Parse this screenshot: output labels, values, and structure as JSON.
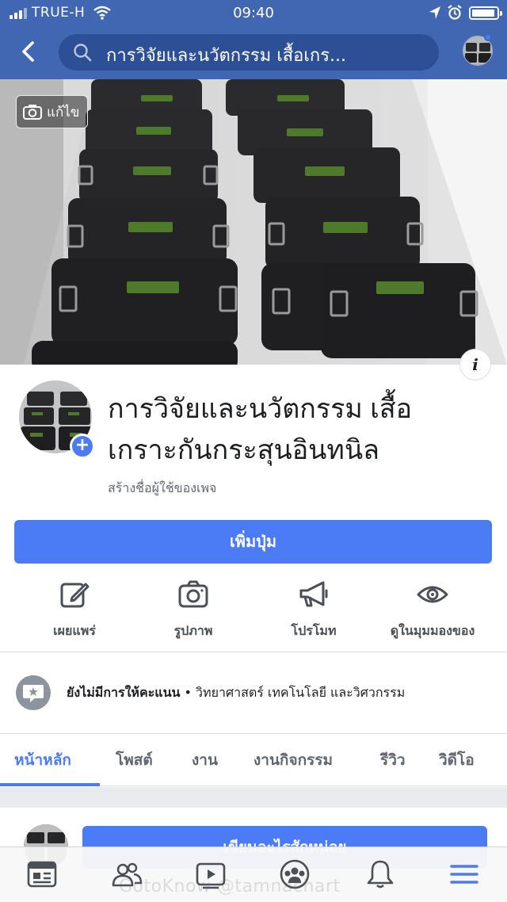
{
  "status_bar": {
    "carrier": "TRUE-H",
    "time": "09:40"
  },
  "header": {
    "search_text": "การวิจัยและนวัตกรรม เสื้อเกร...",
    "back_icon": "chevron-left-icon",
    "search_icon": "search-icon"
  },
  "cover": {
    "edit_label": "แก้ไข",
    "info_label": "i"
  },
  "profile": {
    "page_name": "การวิจัยและนวัตกรรม เสื้อเกราะกันกระสุนอินทนิล",
    "create_username": "สร้างชื่อผู้ใช้ของเพจ"
  },
  "primary_button": "เพิ่มปุ่ม",
  "actions": [
    {
      "label": "เผยแพร่",
      "icon": "edit-icon"
    },
    {
      "label": "รูปภาพ",
      "icon": "camera-icon"
    },
    {
      "label": "โปรโมท",
      "icon": "megaphone-icon"
    },
    {
      "label": "ดูในมุมมองของ",
      "icon": "eye-icon"
    }
  ],
  "rating": {
    "no_rating": "ยังไม่มีการให้คะแนน",
    "separator": " • ",
    "category": "วิทยาศาสตร์ เทคโนโลยี และวิศวกรรม"
  },
  "tabs": [
    {
      "label": "หน้าหลัก",
      "active": true
    },
    {
      "label": "โพสต์",
      "active": false
    },
    {
      "label": "งาน",
      "active": false
    },
    {
      "label": "งานกิจกรรม",
      "active": false
    },
    {
      "label": "รีวิว",
      "active": false
    },
    {
      "label": "วิดีโอ",
      "active": false
    }
  ],
  "post_button": "เขียนอะไรสักหน่อย",
  "bottom_nav": [
    "news-feed-icon",
    "friends-icon",
    "watch-icon",
    "groups-icon",
    "notifications-icon",
    "menu-icon"
  ],
  "watermark": "GotoKnow @tamnachart",
  "colors": {
    "brand": "#4267b2",
    "accent": "#4b7bf5",
    "muted": "#606770"
  }
}
